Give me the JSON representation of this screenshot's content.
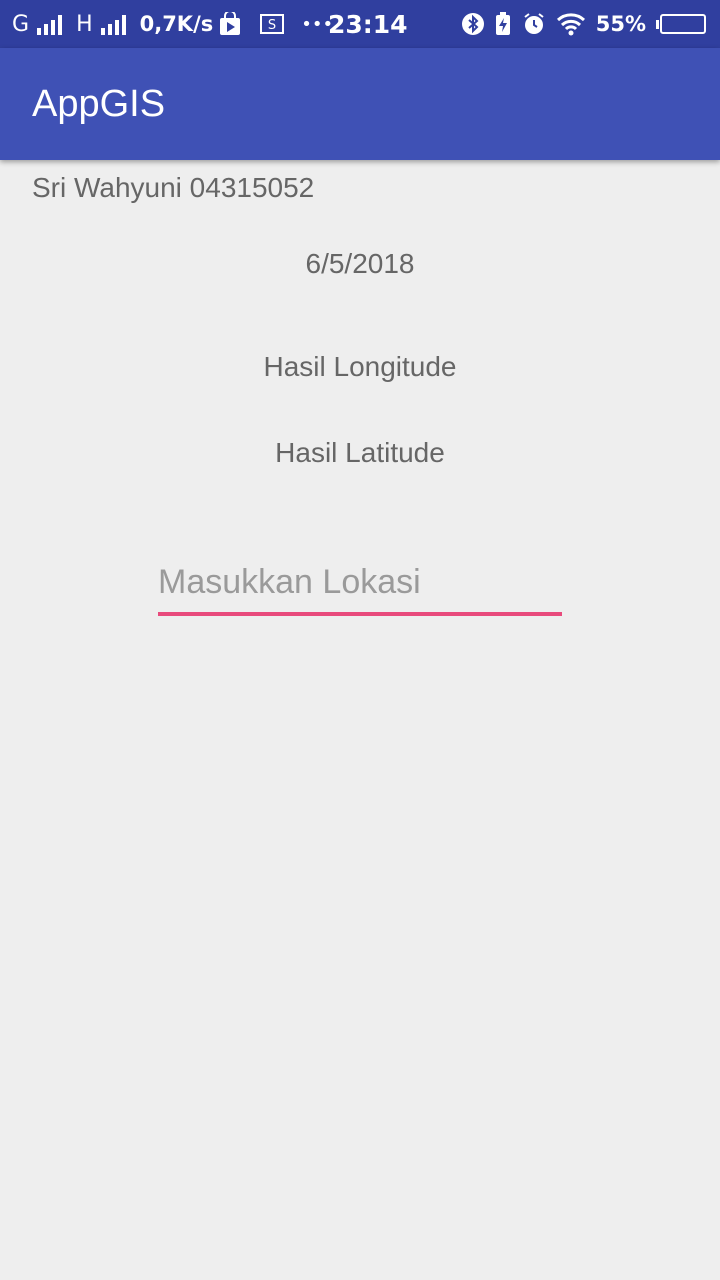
{
  "status_bar": {
    "network1": "G",
    "network2": "H",
    "speed": "0,7K/s",
    "more": "•••",
    "time": "23:14",
    "battery_percent": "55%",
    "battery_level": 0.55,
    "icons": [
      "signal-icon",
      "signal-icon",
      "play-store-icon",
      "screenshot-icon",
      "bluetooth-icon",
      "battery-charging-icon",
      "alarm-icon",
      "wifi-icon",
      "battery-icon"
    ]
  },
  "app_bar": {
    "title": "AppGIS",
    "color": "#3f51b5"
  },
  "main": {
    "name": "Sri Wahyuni 04315052",
    "date": "6/5/2018",
    "longitude_label": "Hasil Longitude",
    "latitude_label": "Hasil Latitude",
    "location_input": {
      "value": "",
      "placeholder": "Masukkan Lokasi",
      "accent": "#e84a7c"
    }
  }
}
